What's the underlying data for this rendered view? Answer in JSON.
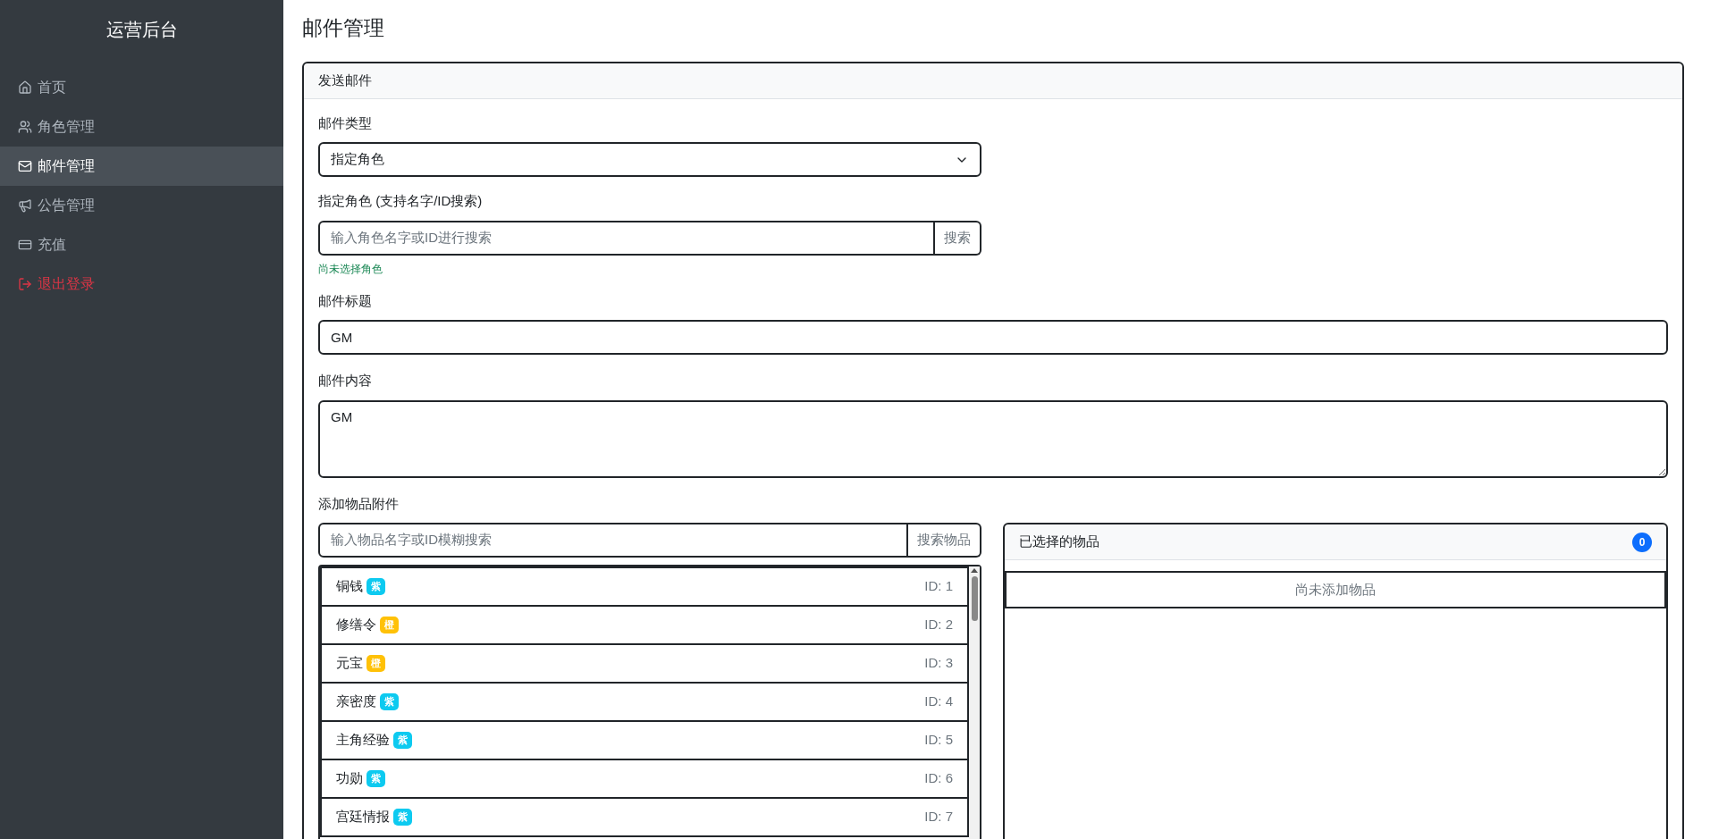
{
  "sidebar": {
    "title": "运营后台",
    "items": [
      {
        "kind": "home",
        "label": "首页",
        "selected": false,
        "danger": false
      },
      {
        "kind": "users",
        "label": "角色管理",
        "selected": false,
        "danger": false
      },
      {
        "kind": "mail",
        "label": "邮件管理",
        "selected": true,
        "danger": false
      },
      {
        "kind": "megaphone",
        "label": "公告管理",
        "selected": false,
        "danger": false
      },
      {
        "kind": "card",
        "label": "充值",
        "selected": false,
        "danger": false
      },
      {
        "kind": "logout",
        "label": "退出登录",
        "selected": false,
        "danger": true
      }
    ]
  },
  "page_title": "邮件管理",
  "card": {
    "title": "发送邮件",
    "mail_type": {
      "label": "邮件类型",
      "value": "指定角色"
    },
    "target": {
      "label": "指定角色 (支持名字/ID搜索)",
      "placeholder": "输入角色名字或ID进行搜索",
      "button": "搜索",
      "hint": "尚未选择角色"
    },
    "subject": {
      "label": "邮件标题",
      "value": "GM"
    },
    "content": {
      "label": "邮件内容",
      "value": "GM"
    },
    "attachments": {
      "label": "添加物品附件",
      "placeholder": "输入物品名字或ID模糊搜索",
      "button": "搜索物品",
      "items": [
        {
          "name": "铜钱",
          "tag": "紫",
          "color": "#0dcaf0",
          "id": "ID: 1"
        },
        {
          "name": "修缮令",
          "tag": "橙",
          "color": "#ffc107",
          "id": "ID: 2"
        },
        {
          "name": "元宝",
          "tag": "橙",
          "color": "#ffc107",
          "id": "ID: 3"
        },
        {
          "name": "亲密度",
          "tag": "紫",
          "color": "#0dcaf0",
          "id": "ID: 4"
        },
        {
          "name": "主角经验",
          "tag": "紫",
          "color": "#0dcaf0",
          "id": "ID: 5"
        },
        {
          "name": "功勋",
          "tag": "紫",
          "color": "#0dcaf0",
          "id": "ID: 6"
        },
        {
          "name": "宫廷情报",
          "tag": "紫",
          "color": "#0dcaf0",
          "id": "ID: 7"
        }
      ],
      "selected_panel": {
        "title": "已选择的物品",
        "count": "0",
        "empty_text": "尚未添加物品"
      }
    }
  }
}
